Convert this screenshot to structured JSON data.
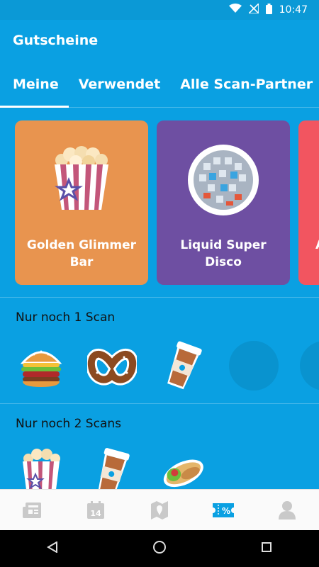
{
  "status_bar": {
    "time": "10:47"
  },
  "app_bar": {
    "title": "Gutscheine"
  },
  "tabs": [
    {
      "label": "Meine",
      "active": true
    },
    {
      "label": "Verwendet",
      "active": false
    },
    {
      "label": "Alle Scan-Partner",
      "active": false
    }
  ],
  "cards": [
    {
      "label": "Golden Glimmer Bar",
      "color": "#e8944f",
      "icon": "popcorn-icon"
    },
    {
      "label": "Liquid Super Disco",
      "color": "#6e4fa2",
      "icon": "disco-ball-icon"
    },
    {
      "label": "A",
      "color": "#f25560",
      "icon": ""
    }
  ],
  "sections": [
    {
      "title": "Nur noch 1 Scan",
      "icons": [
        "burger-icon",
        "pretzel-icon",
        "coffee-cup-icon"
      ]
    },
    {
      "title": "Nur noch 2 Scans",
      "icons": [
        "popcorn-icon",
        "coffee-cup-icon",
        "wrap-icon"
      ]
    }
  ],
  "bottom_nav": {
    "items": [
      "news-icon",
      "calendar-icon",
      "map-icon",
      "coupon-icon",
      "profile-icon"
    ],
    "calendar_day": "14",
    "coupon_glyph": "%",
    "active_color": "#0aa0e2",
    "inactive_color": "#c9c9c9"
  }
}
